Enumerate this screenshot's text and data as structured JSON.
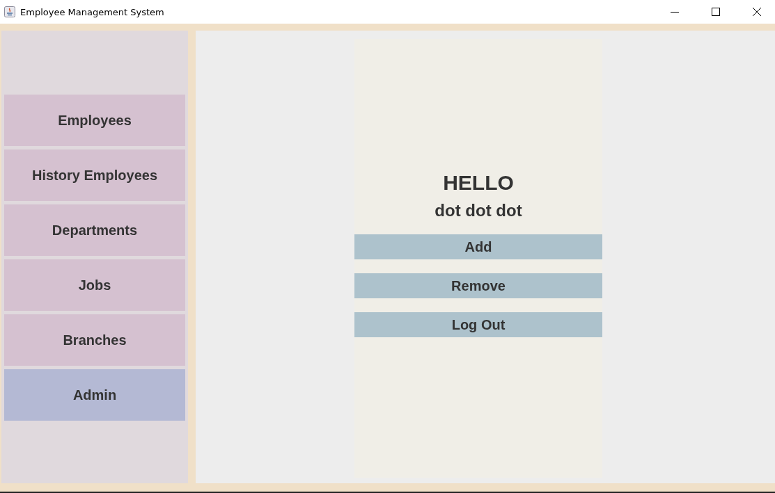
{
  "window": {
    "title": "Employee Management System"
  },
  "sidebar": {
    "items": [
      {
        "label": "Employees",
        "selected": false
      },
      {
        "label": "History Employees",
        "selected": false
      },
      {
        "label": "Departments",
        "selected": false
      },
      {
        "label": "Jobs",
        "selected": false
      },
      {
        "label": "Branches",
        "selected": false
      },
      {
        "label": "Admin",
        "selected": true
      }
    ]
  },
  "main": {
    "heading": "HELLO",
    "subheading": "dot dot dot",
    "buttons": [
      "Add",
      "Remove",
      "Log Out"
    ]
  }
}
